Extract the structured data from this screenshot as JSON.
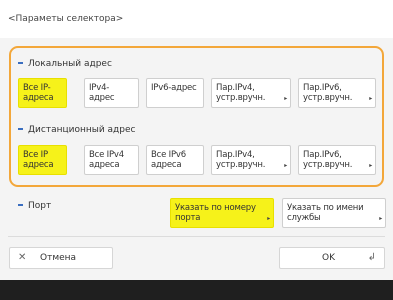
{
  "header": {
    "title": "<Параметы селектора>"
  },
  "local": {
    "label": "Локальный адрес",
    "buttons": [
      {
        "label": "Все IP-адреса",
        "selected": true
      },
      {
        "label": "IPv4-адрес",
        "selected": false
      },
      {
        "label": "IPv6-адрес",
        "selected": false
      },
      {
        "label": "Пар.IPv4, устр.вручн.",
        "selected": false
      },
      {
        "label": "Пар.IPv6, устр.вручн.",
        "selected": false
      }
    ]
  },
  "remote": {
    "label": "Дистанционный адрес",
    "buttons": [
      {
        "label": "Все IP адреса",
        "selected": true
      },
      {
        "label": "Все IPv4 адреса",
        "selected": false
      },
      {
        "label": "Все IPv6 адреса",
        "selected": false
      },
      {
        "label": "Пар.IPv4, устр.вручн.",
        "selected": false
      },
      {
        "label": "Пар.IPv6, устр.вручн.",
        "selected": false
      }
    ]
  },
  "port": {
    "label": "Порт",
    "by_number": "Указать по номеру порта",
    "by_service": "Указать по имени службы"
  },
  "footer": {
    "cancel_label": "Отмена",
    "ok_label": "OK"
  },
  "colors": {
    "accent_border": "#f3a73a",
    "selected": "#f6f21a",
    "bottom_bar": "#1f1f1f"
  }
}
